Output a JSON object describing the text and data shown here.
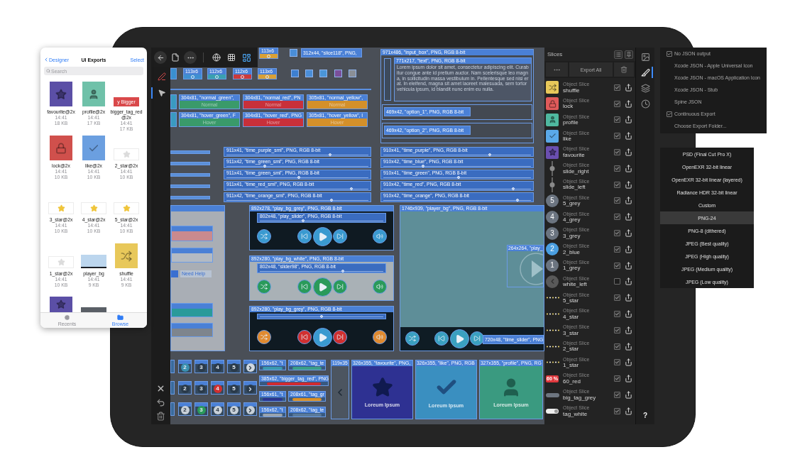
{
  "files_panel": {
    "back": "Designer",
    "title": "UI Exports",
    "action": "Select",
    "search": {
      "placeholder": "Search"
    },
    "files": [
      {
        "name": "favourite@2x",
        "time": "14:41",
        "size": "18 KB",
        "kind": "favourite",
        "color": "#5b4fa6"
      },
      {
        "name": "profile@2x",
        "time": "14:41",
        "size": "17 KB",
        "kind": "profile",
        "color": "#6fc1a9"
      },
      {
        "name": "bigger_tag_red@2x",
        "time": "14:41",
        "size": "17 KB",
        "kind": "tag",
        "color": "#d9484a"
      },
      {
        "name": "lock@2x",
        "time": "14:41",
        "size": "10 KB",
        "kind": "lock",
        "color": "#d0504c"
      },
      {
        "name": "like@2x",
        "time": "14:41",
        "size": "10 KB",
        "kind": "like",
        "color": "#6b9fe0"
      },
      {
        "name": "2_star@2x",
        "time": "14:41",
        "size": "10 KB",
        "kind": "star",
        "color": "#dcdcdc"
      },
      {
        "name": "3_star@2x",
        "time": "14:41",
        "size": "10 KB",
        "kind": "star",
        "color": "#f0c53a"
      },
      {
        "name": "4_star@2x",
        "time": "14:41",
        "size": "10 KB",
        "kind": "star",
        "color": "#f0c53a"
      },
      {
        "name": "5_star@2x",
        "time": "14:41",
        "size": "10 KB",
        "kind": "star",
        "color": "#f0c53a"
      },
      {
        "name": "1_star@2x",
        "time": "14:41",
        "size": "10 KB",
        "kind": "star",
        "color": "#dcdcdc"
      },
      {
        "name": "player_bg",
        "time": "14:41",
        "size": "9 KB",
        "kind": "player",
        "color": "#bcd6ee"
      },
      {
        "name": "shuffle",
        "time": "14:41",
        "size": "9 KB",
        "kind": "shuffle",
        "color": "#e8c85a"
      }
    ],
    "tag_preview": {
      "text": "y Bigger"
    },
    "more_files": [
      {
        "kind": "favourite",
        "color": "#5b4fa6"
      },
      {
        "kind": "bar",
        "color": "#5a5f66"
      }
    ],
    "tabs": [
      {
        "label": "Recents",
        "kind": "recents",
        "selected": false
      },
      {
        "label": "Browse",
        "kind": "browse",
        "selected": true
      }
    ]
  },
  "left_tools": [
    {
      "kind": "pen",
      "selected": false
    },
    {
      "kind": "pointer",
      "selected": true
    }
  ],
  "canvas": {
    "ring_slices": [
      {
        "label": "113x6",
        "color": "#d9a035"
      },
      {
        "label": "113x6",
        "color": "#3f8fd0"
      },
      {
        "label": "112x6",
        "color": "#3aa0b0"
      },
      {
        "label": "112x6",
        "color": "#cc3a3a"
      },
      {
        "label": "113x6",
        "color": "#d9a035"
      }
    ],
    "swatch_slices": [
      {
        "color": "#4a8ed8"
      },
      {
        "color": "#3d7fd0"
      },
      {
        "color": "#4a8ed8"
      },
      {
        "color": "#4a96d8"
      },
      {
        "color": "#7a4f9a"
      },
      {
        "color": "#8a8f96"
      }
    ],
    "name_slice": {
      "label": "312x44, \"slice118\", PNG,"
    },
    "button_slices": [
      {
        "label": "304x81, \"normal_green\",",
        "caption": "Normal",
        "color": "#3a9a6a"
      },
      {
        "label": "304x81, \"normal_red\", PN",
        "caption": "Normal",
        "color": "#c8303a"
      },
      {
        "label": "305x81, \"normal_yellow\",",
        "caption": "Normal",
        "color": "#d4902a"
      },
      {
        "label": "304x81, \"hover_green\", F",
        "caption": "Hover",
        "color": "#3a9a6a"
      },
      {
        "label": "304x81, \"hover_red\", PNG",
        "caption": "Hover",
        "color": "#c8303a"
      },
      {
        "label": "305x81, \"hover_yellow\", I",
        "caption": "Hover",
        "color": "#d4902a"
      }
    ],
    "input_box": {
      "label": "971x486, \"input_box\", PNG, RGB 8-bit",
      "text_label": "771x217, \"text\", PNG, RGB 8-bit",
      "text": "Lorem ipsum dolor sit amet, consectetur adipiscing elit. Curabitur congue ante id pretium auctor. Nam scelerisque leo magna, in sollicitudin massa vestibulum in. Pellentesque sed nisi erat. In eleifend, magna sit amet laoreet malesuada, sem tortor vehicula ipsum, id blandit nunc enim eu nulla.",
      "options": [
        "469x42, \"option_1\", PNG, RGB 8-bit",
        "469x42, \"option_2\", PNG, RGB 8-bit"
      ]
    },
    "sliders": [
      {
        "label": "911x41, \"time_purple_sml\", PNG, RGB 8-bit",
        "level": 0.73
      },
      {
        "label": "911x42, \"time_green_sml\", PNG, RGB 8-bit",
        "level": 0.27
      },
      {
        "label": "911x41, \"time_green_sml\", PNG, RGB 8-bit",
        "level": 0.51
      },
      {
        "label": "911x41, \"time_red_sml\", PNG, RGB 8-bit",
        "level": 0.88
      },
      {
        "label": "911x42, \"time_orange_sml\", PNG, RGB 8-bit",
        "level": 0.74
      },
      {
        "label": "910x41, \"time_purple\", PNG, RGB 8-bit",
        "level": 0.72
      },
      {
        "label": "910x42, \"time_blue\", PNG, RGB 8-bit",
        "level": 0.27
      },
      {
        "label": "910x41, \"time_green\", PNG, RGB 8-bit",
        "level": 0.51
      },
      {
        "label": "910x42, \"time_red\", PNG, RGB 8-bit",
        "level": 0.88
      },
      {
        "label": "910x42, \"time_orange\", PNG, RGB 8-bit",
        "level": 0.91
      }
    ],
    "side_panel": {
      "help_text": "Need Help"
    },
    "players": [
      {
        "label": "892x278, \"play_bg_grey\", PNG, RGB 8-bit",
        "slider_label": "802x48, \"play_slider\", PNG, RGB 8-bit",
        "kind": "dark",
        "level": 0.35,
        "buttons": [
          {
            "kind": "shuffle",
            "color": "#3a9ad0"
          },
          {
            "kind": "previous",
            "color": "#3a9ad0"
          },
          {
            "kind": "play",
            "color": "#3a9ad0"
          },
          {
            "kind": "next",
            "color": "#3a9ad0"
          },
          {
            "kind": "volume",
            "color": "#3a9ad0"
          }
        ]
      },
      {
        "label": "892x280, \"play_bg_white\", PNG, RGB 8-bit",
        "slider_label": "802x48, \"slider98\", PNG, RGB 8-bit",
        "kind": "light",
        "level": 0.67,
        "buttons": [
          {
            "kind": "shuffle",
            "color": "#2a9a5a"
          },
          {
            "kind": "previous",
            "color": "#2a9a5a"
          },
          {
            "kind": "play",
            "color": "#2a9a5a"
          },
          {
            "kind": "next",
            "color": "#2a9a5a"
          },
          {
            "kind": "volume",
            "color": "#2a9a5a"
          }
        ]
      },
      {
        "label": "892x280, \"play_bg_grey\", PNG, RGB 8-bit",
        "kind": "dark",
        "level": 0.5,
        "buttons": [
          {
            "kind": "shuffle",
            "color": "#e08a30"
          },
          {
            "kind": "previous",
            "color": "#d03030"
          },
          {
            "kind": "play",
            "color": "#3a9ad0"
          },
          {
            "kind": "next",
            "color": "#d03030"
          },
          {
            "kind": "volume",
            "color": "#e08a30"
          }
        ]
      }
    ],
    "player_bg": {
      "label": "1746x939, \"player_bg\", PNG, RGB 8-bit",
      "inset_label": "264x264, \"play_",
      "slider_label": "720x48, \"time_slider\", PNG",
      "buttons": [
        {
          "kind": "shuffle",
          "color": "#3aa0c0"
        },
        {
          "kind": "previous",
          "color": "#3aa0c0"
        },
        {
          "kind": "play",
          "color": "#3aa0c0"
        },
        {
          "kind": "next",
          "color": "#3aa0c0"
        }
      ]
    },
    "number_tiles": [
      {
        "kind": "digit",
        "text": "2",
        "color": "#3a90b0"
      },
      {
        "kind": "digit",
        "text": "3",
        "color": "#2a3a4a"
      },
      {
        "kind": "digit",
        "text": "4",
        "color": "#2a3a4a"
      },
      {
        "kind": "digit",
        "text": "5",
        "color": "#2a3a4a"
      },
      {
        "kind": "arrow",
        "color": "#d0d8e0"
      },
      {
        "kind": "digit",
        "text": "2",
        "color": "#2a3a4a"
      },
      {
        "kind": "digit",
        "text": "3",
        "color": "#2a3a4a"
      },
      {
        "kind": "digit",
        "text": "4",
        "color": "#d03030"
      },
      {
        "kind": "digit",
        "text": "5",
        "color": "#2a3a4a"
      },
      {
        "kind": "arrow",
        "color": "#2a3a4a"
      },
      {
        "kind": "digit",
        "text": "2",
        "color": "#c8d0d8"
      },
      {
        "kind": "digit",
        "text": "3",
        "color": "#2a9a5a"
      },
      {
        "kind": "digit",
        "text": "4",
        "color": "#c8d0d8"
      },
      {
        "kind": "digit",
        "text": "5",
        "color": "#c8d0d8"
      },
      {
        "kind": "arrow",
        "color": "#c8d0d8"
      }
    ],
    "tag_slices": [
      {
        "label": "156x62, \"t",
        "color": "#3a9ab0"
      },
      {
        "label": "208x62, \"tag_te",
        "color": "#3aa08a"
      },
      {
        "label": "385x62, \"bigger_tag_red\", PNG",
        "color": "#d02a30"
      },
      {
        "label": "156x61, \"t",
        "color": "#2a3590"
      },
      {
        "label": "208x61, \"tag_gr",
        "color": "#d8902a"
      },
      {
        "label": "156x62, \"t",
        "color": "#9aa4ae"
      },
      {
        "label": "208x62, \"tag_te",
        "color": "#5a7a9a"
      }
    ],
    "cards": [
      {
        "kind": "back",
        "label": "119x35",
        "color": "#4c5560"
      },
      {
        "kind": "favourite",
        "label": "326x355, \"favourite\", PNG,",
        "caption": "Loreum Ipsum",
        "color": "#2e3192"
      },
      {
        "kind": "like",
        "label": "326x355, \"like\", PNG, RGB",
        "caption": "Loreum Ipsum",
        "color": "#3a8fc0"
      },
      {
        "kind": "profile",
        "label": "327x355, \"profile\", PNG, RG",
        "caption": "Loreum Ipsum",
        "color": "#3a9a80"
      }
    ]
  },
  "slices_panel": {
    "title": "Slices",
    "export_all": "Export All",
    "slices": [
      {
        "name": "shuffle",
        "subtitle": "Object Slice",
        "kind": "shuffle",
        "color": "#e8c85a",
        "checked": true
      },
      {
        "name": "lock",
        "subtitle": "Object Slice",
        "kind": "lock",
        "color": "#e05a5a",
        "checked": true
      },
      {
        "name": "profile",
        "subtitle": "Object Slice",
        "kind": "profile",
        "color": "#4fb8a0",
        "checked": true
      },
      {
        "name": "like",
        "subtitle": "Object Slice",
        "kind": "like",
        "color": "#5aa8e8",
        "checked": true
      },
      {
        "name": "favourite",
        "subtitle": "Object Slice",
        "kind": "favourite",
        "color": "#6a4fb0",
        "checked": true
      },
      {
        "name": "slide_right",
        "subtitle": "Object Slice",
        "kind": "knob",
        "checked": true
      },
      {
        "name": "slide_left",
        "subtitle": "Object Slice",
        "kind": "knob",
        "checked": true
      },
      {
        "name": "5_grey",
        "subtitle": "Object Slice",
        "kind": "number",
        "text": "5",
        "color": "#6b7480",
        "checked": true
      },
      {
        "name": "4_grey",
        "subtitle": "Object Slice",
        "kind": "number",
        "text": "4",
        "color": "#6b7480",
        "checked": true
      },
      {
        "name": "3_grey",
        "subtitle": "Object Slice",
        "kind": "number",
        "text": "3",
        "color": "#6b7480",
        "checked": true
      },
      {
        "name": "2_blue",
        "subtitle": "Object Slice",
        "kind": "number",
        "text": "2",
        "color": "#4a9ee0",
        "checked": true
      },
      {
        "name": "1_grey",
        "subtitle": "Object Slice",
        "kind": "number",
        "text": "1",
        "color": "#6b7480",
        "checked": true
      },
      {
        "name": "white_left",
        "subtitle": "Object Slice",
        "kind": "back",
        "color": "#595959",
        "checked": false
      },
      {
        "name": "5_star",
        "subtitle": "Object Slice",
        "kind": "stars",
        "checked": true
      },
      {
        "name": "4_star",
        "subtitle": "Object Slice",
        "kind": "stars",
        "checked": true
      },
      {
        "name": "3_star",
        "subtitle": "Object Slice",
        "kind": "stars",
        "checked": true
      },
      {
        "name": "2_star",
        "subtitle": "Object Slice",
        "kind": "stars",
        "checked": true
      },
      {
        "name": "1_star",
        "subtitle": "Object Slice",
        "kind": "stars",
        "checked": true
      },
      {
        "name": "60_red",
        "subtitle": "Object Slice",
        "kind": "tag_red",
        "text": "60 %",
        "checked": true
      },
      {
        "name": "big_tag_grey",
        "subtitle": "Object Slice",
        "kind": "tag_grey",
        "checked": true
      },
      {
        "name": "tag_white",
        "subtitle": "Object Slice",
        "kind": "tag_white",
        "checked": true
      }
    ]
  },
  "right_tools": [
    {
      "kind": "export_image",
      "selected": false
    },
    {
      "kind": "slices",
      "selected": true
    },
    {
      "kind": "layers",
      "selected": false
    },
    {
      "kind": "history",
      "selected": false
    }
  ],
  "help": "?",
  "json_menu": [
    {
      "label": "No JSON output",
      "checked": true
    },
    {
      "label": "Xcode JSON - Apple Universal Icon",
      "checked": false
    },
    {
      "label": "Xcode JSON - macOS Application Icon",
      "checked": false
    },
    {
      "label": "Xcode JSON - Stub",
      "checked": false
    },
    {
      "label": "Spine JSON",
      "checked": false
    },
    {
      "label": "Continuous Export",
      "checked": true
    },
    {
      "label": "Choose Export Folder...",
      "checked": false
    }
  ],
  "format_menu": [
    {
      "label": "PSD (Final Cut Pro X)",
      "selected": false
    },
    {
      "label": "OpenEXR 32-bit linear",
      "selected": false
    },
    {
      "label": "OpenEXR 32-bit linear (layered)",
      "selected": false
    },
    {
      "label": "Radiance HDR 32-bit linear",
      "selected": false
    },
    {
      "label": "Custom",
      "selected": false
    },
    {
      "label": "PNG-24",
      "selected": true
    },
    {
      "label": "PNG-8 (dithered)",
      "selected": false
    },
    {
      "label": "JPEG (Best quality)",
      "selected": false
    },
    {
      "label": "JPEG (High quality)",
      "selected": false
    },
    {
      "label": "JPEG (Medium quality)",
      "selected": false
    },
    {
      "label": "JPEG (Low quality)",
      "selected": false
    }
  ]
}
